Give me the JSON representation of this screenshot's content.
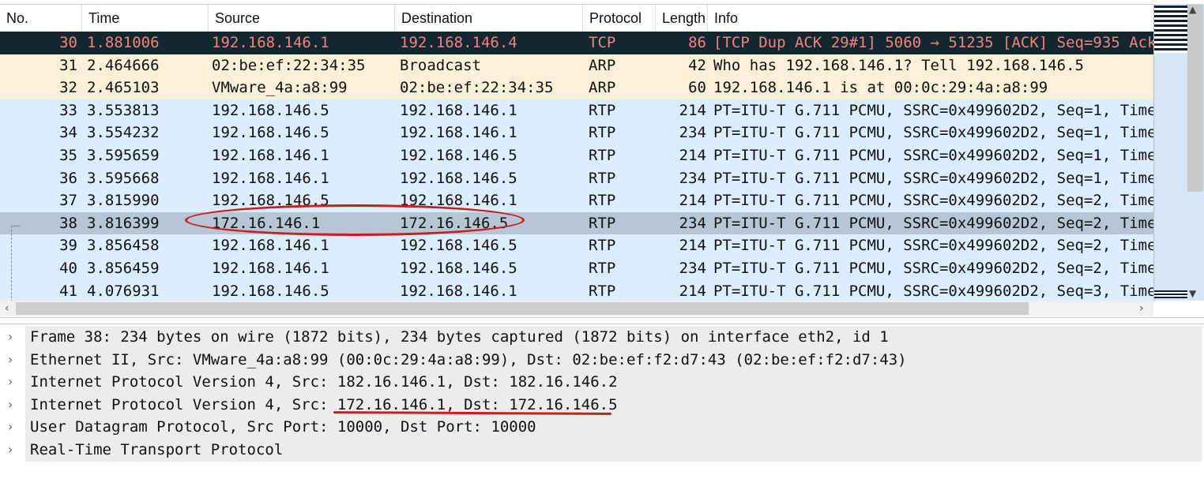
{
  "columns": [
    "No.",
    "Time",
    "Source",
    "Destination",
    "Protocol",
    "Length",
    "Info"
  ],
  "packets": [
    {
      "no": "30",
      "time": "1.881006",
      "src": "192.168.146.1",
      "dst": "192.168.146.4",
      "proto": "TCP",
      "len": "86",
      "info": "[TCP Dup ACK 29#1] 5060 → 51235 [ACK] Seq=935 Ack",
      "style": "dark"
    },
    {
      "no": "31",
      "time": "2.464666",
      "src": "02:be:ef:22:34:35",
      "dst": "Broadcast",
      "proto": "ARP",
      "len": "42",
      "info": "Who has 192.168.146.1? Tell 192.168.146.5",
      "style": "arp"
    },
    {
      "no": "32",
      "time": "2.465103",
      "src": "VMware_4a:a8:99",
      "dst": "02:be:ef:22:34:35",
      "proto": "ARP",
      "len": "60",
      "info": "192.168.146.1 is at 00:0c:29:4a:a8:99",
      "style": "arp"
    },
    {
      "no": "33",
      "time": "3.553813",
      "src": "192.168.146.5",
      "dst": "192.168.146.1",
      "proto": "RTP",
      "len": "214",
      "info": "PT=ITU-T G.711 PCMU, SSRC=0x499602D2, Seq=1, Time",
      "style": "rtp"
    },
    {
      "no": "34",
      "time": "3.554232",
      "src": "192.168.146.5",
      "dst": "192.168.146.1",
      "proto": "RTP",
      "len": "234",
      "info": "PT=ITU-T G.711 PCMU, SSRC=0x499602D2, Seq=1, Time",
      "style": "rtp"
    },
    {
      "no": "35",
      "time": "3.595659",
      "src": "192.168.146.1",
      "dst": "192.168.146.5",
      "proto": "RTP",
      "len": "214",
      "info": "PT=ITU-T G.711 PCMU, SSRC=0x499602D2, Seq=1, Time",
      "style": "rtp"
    },
    {
      "no": "36",
      "time": "3.595668",
      "src": "192.168.146.1",
      "dst": "192.168.146.5",
      "proto": "RTP",
      "len": "234",
      "info": "PT=ITU-T G.711 PCMU, SSRC=0x499602D2, Seq=1, Time",
      "style": "rtp"
    },
    {
      "no": "37",
      "time": "3.815990",
      "src": "192.168.146.5",
      "dst": "192.168.146.1",
      "proto": "RTP",
      "len": "214",
      "info": "PT=ITU-T G.711 PCMU, SSRC=0x499602D2, Seq=2, Time",
      "style": "rtp"
    },
    {
      "no": "38",
      "time": "3.816399",
      "src": "172.16.146.1",
      "dst": "172.16.146.5",
      "proto": "RTP",
      "len": "234",
      "info": "PT=ITU-T G.711 PCMU, SSRC=0x499602D2, Seq=2, Time",
      "style": "selected"
    },
    {
      "no": "39",
      "time": "3.856458",
      "src": "192.168.146.1",
      "dst": "192.168.146.5",
      "proto": "RTP",
      "len": "214",
      "info": "PT=ITU-T G.711 PCMU, SSRC=0x499602D2, Seq=2, Time",
      "style": "rtp"
    },
    {
      "no": "40",
      "time": "3.856459",
      "src": "192.168.146.1",
      "dst": "192.168.146.5",
      "proto": "RTP",
      "len": "234",
      "info": "PT=ITU-T G.711 PCMU, SSRC=0x499602D2, Seq=2, Time",
      "style": "rtp"
    },
    {
      "no": "41",
      "time": "4.076931",
      "src": "192.168.146.5",
      "dst": "192.168.146.1",
      "proto": "RTP",
      "len": "214",
      "info": "PT=ITU-T G.711 PCMU, SSRC=0x499602D2, Seq=3, Time",
      "style": "rtp"
    }
  ],
  "row_colors": {
    "dark": {
      "bg": "#12272e",
      "fg": "#f78080"
    },
    "arp": {
      "bg": "#faf0d7",
      "fg": "#121212"
    },
    "rtp": {
      "bg": "#daeeff",
      "fg": "#121212"
    },
    "selected": {
      "bg": "#b7c6d4",
      "fg": "#121212"
    }
  },
  "details": [
    "Frame 38: 234 bytes on wire (1872 bits), 234 bytes captured (1872 bits) on interface eth2, id 1",
    "Ethernet II, Src: VMware_4a:a8:99 (00:0c:29:4a:a8:99), Dst: 02:be:ef:f2:d7:43 (02:be:ef:f2:d7:43)",
    "Internet Protocol Version 4, Src: 182.16.146.1, Dst: 182.16.146.2",
    "Internet Protocol Version 4, Src: 172.16.146.1, Dst: 172.16.146.5",
    "User Datagram Protocol, Src Port: 10000, Dst Port: 10000",
    "Real-Time Transport Protocol"
  ],
  "icons": {
    "expand": "chevron-right-icon",
    "scroll_left": "chevron-left-icon",
    "scroll_right": "chevron-right-icon"
  },
  "annotation_color": "#c81e1e"
}
